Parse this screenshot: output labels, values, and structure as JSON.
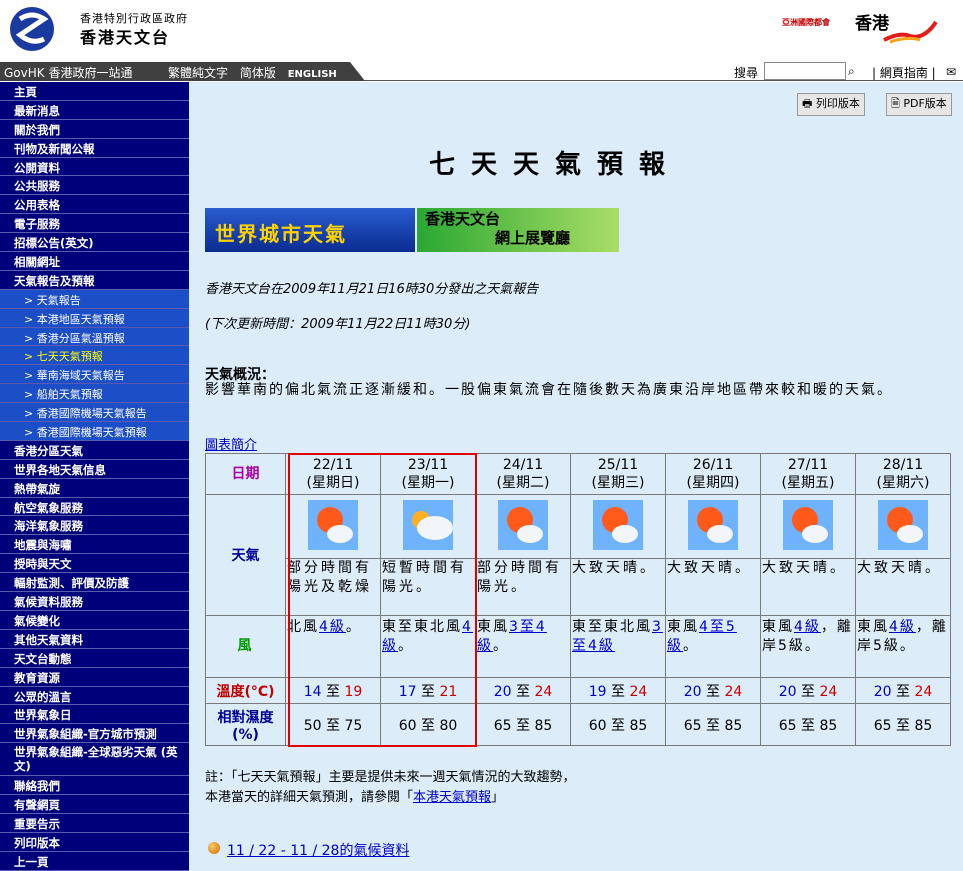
{
  "header": {
    "org_line1": "香港特別行政區政府",
    "org_line2": "香港天文台",
    "brand_small": "亞洲國際都會",
    "brand_hk": "香港"
  },
  "topnav": {
    "govhk": "GovHK 香港政府一站通",
    "lang_trad": "繁體純文字",
    "lang_simp": "简体版",
    "lang_en": "ENGLISH",
    "search_label": "搜尋",
    "search_btn": "⌕",
    "sitemap": "| 網頁指南 |"
  },
  "sidebar": [
    {
      "label": "主頁",
      "type": "main"
    },
    {
      "label": "最新消息",
      "type": "main"
    },
    {
      "label": "關於我們",
      "type": "main"
    },
    {
      "label": "刊物及新聞公報",
      "type": "main"
    },
    {
      "label": "公開資料",
      "type": "main"
    },
    {
      "label": "公共服務",
      "type": "main"
    },
    {
      "label": "公用表格",
      "type": "main"
    },
    {
      "label": "電子服務",
      "type": "main"
    },
    {
      "label": "招標公告(英文)",
      "type": "main"
    },
    {
      "label": "相關網址",
      "type": "main"
    },
    {
      "label": "天氣報告及預報",
      "type": "main"
    },
    {
      "label": "> 天氣報告",
      "type": "sub"
    },
    {
      "label": "> 本港地區天氣預報",
      "type": "sub"
    },
    {
      "label": "> 香港分區氣溫預報",
      "type": "sub"
    },
    {
      "label": "> 七天天氣預報",
      "type": "sub",
      "active": true
    },
    {
      "label": "> 華南海域天氣報告",
      "type": "sub"
    },
    {
      "label": "> 船舶天氣預報",
      "type": "sub"
    },
    {
      "label": "> 香港國際機場天氣報告",
      "type": "sub"
    },
    {
      "label": "> 香港國際機場天氣預報",
      "type": "sub"
    },
    {
      "label": "香港分區天氣",
      "type": "main"
    },
    {
      "label": "世界各地天氣信息",
      "type": "main"
    },
    {
      "label": "熱帶氣旋",
      "type": "main"
    },
    {
      "label": "航空氣象服務",
      "type": "main"
    },
    {
      "label": "海洋氣象服務",
      "type": "main"
    },
    {
      "label": "地震與海嘯",
      "type": "main"
    },
    {
      "label": "授時與天文",
      "type": "main"
    },
    {
      "label": "輻射監測、評價及防護",
      "type": "main"
    },
    {
      "label": "氣候資料服務",
      "type": "main"
    },
    {
      "label": "氣候變化",
      "type": "main"
    },
    {
      "label": "其他天氣資料",
      "type": "main"
    },
    {
      "label": "天文台動態",
      "type": "main"
    },
    {
      "label": "教育資源",
      "type": "main"
    },
    {
      "label": "公眾的溫言",
      "type": "main"
    },
    {
      "label": "世界氣象日",
      "type": "main"
    },
    {
      "label": "世界氣象組織-官方城市預測",
      "type": "main"
    },
    {
      "label": "世界氣象組織-全球惡劣天氣 (英文)",
      "type": "main",
      "two_line": true
    },
    {
      "label": "聯絡我們",
      "type": "main"
    },
    {
      "label": "有聲網頁",
      "type": "main"
    },
    {
      "label": "重要告示",
      "type": "main"
    },
    {
      "label": "列印版本",
      "type": "main"
    },
    {
      "label": "上一頁",
      "type": "main"
    }
  ],
  "main": {
    "print_btn": "🖶 列印版本",
    "pdf_btn": "🗎 PDF版本",
    "title": "七天天氣預報",
    "banner_world": "世界城市天氣",
    "banner_hko_1": "香港天文台",
    "banner_hko_2": "網上展覽廳",
    "issued": "香港天文台在2009年11月21日16時30分發出之天氣報告",
    "next_update": "(下次更新時間：2009年11月22日11時30分)",
    "overview_title": "天氣概況：",
    "overview_text": "影響華南的偏北氣流正逐漸緩和。一股偏東氣流會在隨後數天為廣東沿岸地區帶來較和暖的天氣。",
    "chart_intro": "圖表簡介",
    "row_labels": {
      "date": "日期",
      "weather": "天氣",
      "wind": "風",
      "temp": "溫度(°C)",
      "rh": "相對濕度 (%)"
    },
    "temp_sep": "至",
    "note1": "註：「七天天氣預報」主要是提供未來一週天氣情況的大致趨勢，",
    "note2_pre": "本港當天的詳細天氣預測，請參閱「",
    "note2_link": "本港天氣預報",
    "note2_post": "」",
    "climate_link": "11 / 22 - 11 / 28的氣候資料"
  },
  "forecast": [
    {
      "date": "22/11",
      "weekday": "(星期日)",
      "icon": "sun-cloud-icon",
      "desc": "部分時間有陽光及乾燥",
      "wind_pre": "北風",
      "wind_link": "4級",
      "wind_post": "。",
      "tmin": "14",
      "tmax": "19",
      "rh": "50 至 75"
    },
    {
      "date": "23/11",
      "weekday": "(星期一)",
      "icon": "cloud-sun-icon",
      "desc": "短暫時間有陽光。",
      "wind_pre": "東至東北風",
      "wind_link": "4級",
      "wind_post": "。",
      "tmin": "17",
      "tmax": "21",
      "rh": "60 至 80"
    },
    {
      "date": "24/11",
      "weekday": "(星期二)",
      "icon": "sun-cloud-icon",
      "desc": "部分時間有陽光。",
      "wind_pre": "東風",
      "wind_link": "3至4級",
      "wind_post": "。",
      "tmin": "20",
      "tmax": "24",
      "rh": "65 至 85"
    },
    {
      "date": "25/11",
      "weekday": "(星期三)",
      "icon": "sun-cloud-icon",
      "desc": "大致天晴。",
      "wind_pre": "東至東北風",
      "wind_link": "3至4級",
      "wind_post": "",
      "tmin": "19",
      "tmax": "24",
      "rh": "60 至 85"
    },
    {
      "date": "26/11",
      "weekday": "(星期四)",
      "icon": "sun-cloud-icon",
      "desc": "大致天晴。",
      "wind_pre": "東風",
      "wind_link": "4至5級",
      "wind_post": "。",
      "tmin": "20",
      "tmax": "24",
      "rh": "65 至 85"
    },
    {
      "date": "27/11",
      "weekday": "(星期五)",
      "icon": "sun-cloud-icon",
      "desc": "大致天晴。",
      "wind_pre": "東風",
      "wind_link": "4級",
      "wind_post": "，離岸5級。",
      "tmin": "20",
      "tmax": "24",
      "rh": "65 至 85"
    },
    {
      "date": "28/11",
      "weekday": "(星期六)",
      "icon": "sun-cloud-icon",
      "desc": "大致天晴。",
      "wind_pre": "東風",
      "wind_link": "4級",
      "wind_post": "，離岸5級。",
      "tmin": "20",
      "tmax": "24",
      "rh": "65 至 85"
    }
  ]
}
